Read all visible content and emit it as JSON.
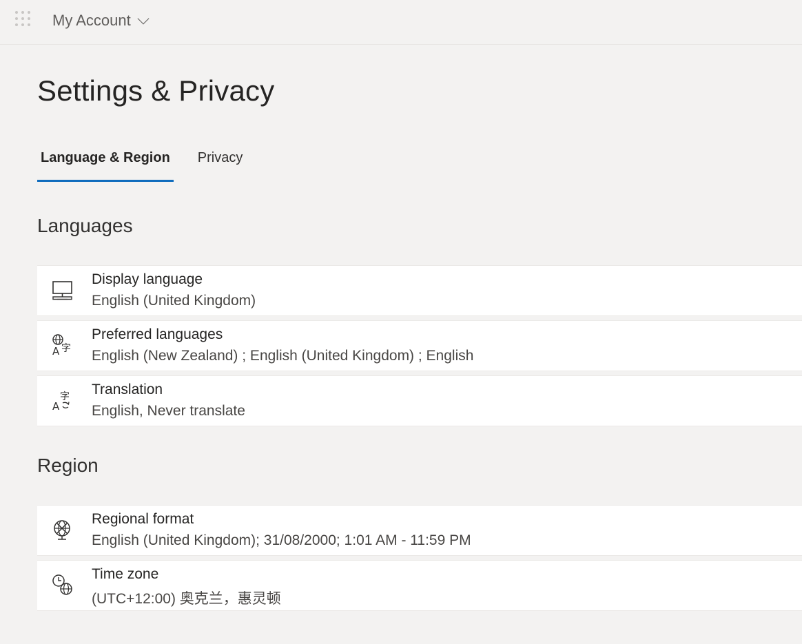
{
  "header": {
    "app_title": "My Account",
    "launcher_icon": "waffle-icon",
    "chevron_icon": "chevron-down-icon"
  },
  "page": {
    "title": "Settings & Privacy"
  },
  "tabs": [
    {
      "label": "Language & Region",
      "active": true
    },
    {
      "label": "Privacy",
      "active": false
    }
  ],
  "languages": {
    "heading": "Languages",
    "items": [
      {
        "title": "Display language",
        "value": "English (United Kingdom)",
        "icon": "monitor-icon"
      },
      {
        "title": "Preferred languages",
        "value": "English (New Zealand) ; English (United Kingdom) ; English",
        "icon": "language-icon"
      },
      {
        "title": "Translation",
        "value": "English, Never translate",
        "icon": "translate-icon"
      }
    ]
  },
  "region": {
    "heading": "Region",
    "items": [
      {
        "title": "Regional format",
        "value": "English (United Kingdom); 31/08/2000; 1:01 AM - 11:59 PM",
        "icon": "globe-format-icon"
      },
      {
        "title": "Time zone",
        "value": "(UTC+12:00) 奥克兰，惠灵顿",
        "icon": "clock-globe-icon"
      }
    ]
  },
  "colors": {
    "accent": "#0f6cbd",
    "background": "#f3f2f1",
    "card": "#ffffff"
  }
}
